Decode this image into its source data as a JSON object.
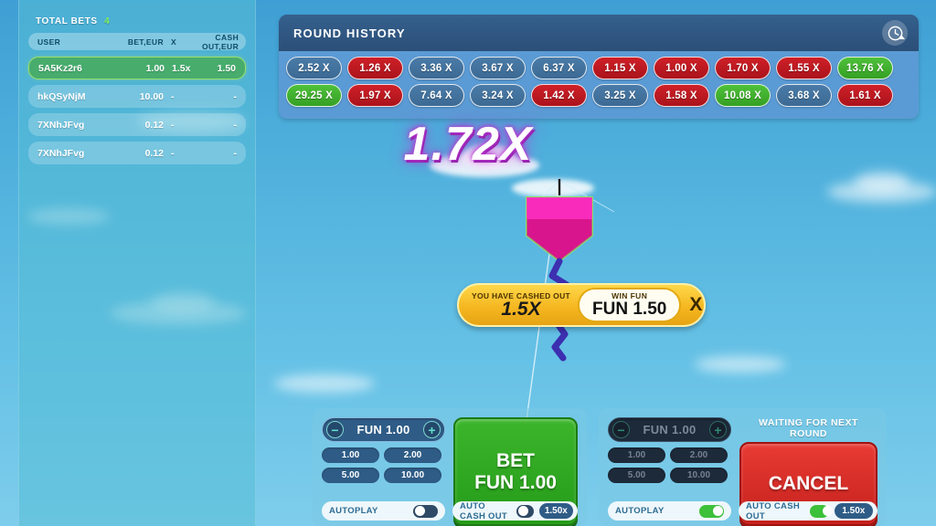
{
  "sidebar": {
    "total_bets_label": "TOTAL BETS",
    "total_bets_count": "4",
    "columns": {
      "user": "USER",
      "bet": "BET,EUR",
      "x": "X",
      "cashout": "CASH OUT,EUR"
    },
    "rows": [
      {
        "user": "5A5Kz2r6",
        "bet": "1.00",
        "x": "1.5x",
        "cashout": "1.50",
        "state": "win"
      },
      {
        "user": "hkQSyNjM",
        "bet": "10.00",
        "x": "-",
        "cashout": "-",
        "state": "pending"
      },
      {
        "user": "7XNhJFvg",
        "bet": "0.12",
        "x": "-",
        "cashout": "-",
        "state": "pending"
      },
      {
        "user": "7XNhJFvg",
        "bet": "0.12",
        "x": "-",
        "cashout": "-",
        "state": "pending"
      }
    ]
  },
  "history": {
    "title": "ROUND HISTORY",
    "clock_icon": "clock-icon",
    "row1": [
      {
        "value": "2.52 X",
        "color": "blue"
      },
      {
        "value": "1.26 X",
        "color": "red"
      },
      {
        "value": "3.36 X",
        "color": "blue"
      },
      {
        "value": "3.67 X",
        "color": "blue"
      },
      {
        "value": "6.37 X",
        "color": "blue"
      },
      {
        "value": "1.15 X",
        "color": "red"
      },
      {
        "value": "1.00 X",
        "color": "red"
      },
      {
        "value": "1.70 X",
        "color": "red"
      },
      {
        "value": "1.55 X",
        "color": "red"
      },
      {
        "value": "13.76 X",
        "color": "green"
      }
    ],
    "row2": [
      {
        "value": "29.25 X",
        "color": "green"
      },
      {
        "value": "1.97 X",
        "color": "red"
      },
      {
        "value": "7.64 X",
        "color": "blue"
      },
      {
        "value": "3.24 X",
        "color": "blue"
      },
      {
        "value": "1.42 X",
        "color": "red"
      },
      {
        "value": "3.25 X",
        "color": "blue"
      },
      {
        "value": "1.58 X",
        "color": "red"
      },
      {
        "value": "10.08 X",
        "color": "green"
      },
      {
        "value": "3.68 X",
        "color": "blue"
      },
      {
        "value": "1.61 X",
        "color": "red"
      }
    ]
  },
  "game": {
    "multiplier": "1.72X",
    "kite_color": "#e8158f"
  },
  "cashout_banner": {
    "label": "YOU HAVE CASHED OUT",
    "value": "1.5X",
    "win_label": "WIN FUN",
    "win_value": "FUN 1.50",
    "x_suffix": "X"
  },
  "bet_panel_left": {
    "amount": "FUN 1.00",
    "minus": "−",
    "plus": "+",
    "quick": [
      "1.00",
      "2.00",
      "5.00",
      "10.00"
    ],
    "action_line1": "BET",
    "action_line2": "FUN 1.00",
    "autoplay_label": "AUTOPLAY",
    "autoplay_on": false,
    "autocashout_label": "AUTO CASH OUT",
    "autocashout_on": false,
    "autocashout_value": "1.50x"
  },
  "bet_panel_right": {
    "amount": "FUN 1.00",
    "minus": "−",
    "plus": "+",
    "quick": [
      "1.00",
      "2.00",
      "5.00",
      "10.00"
    ],
    "status": "WAITING FOR NEXT ROUND",
    "action_line1": "CANCEL",
    "autoplay_label": "AUTOPLAY",
    "autoplay_on": true,
    "autocashout_label": "AUTO CASH OUT",
    "autocashout_on": true,
    "autocashout_value": "1.50x"
  }
}
